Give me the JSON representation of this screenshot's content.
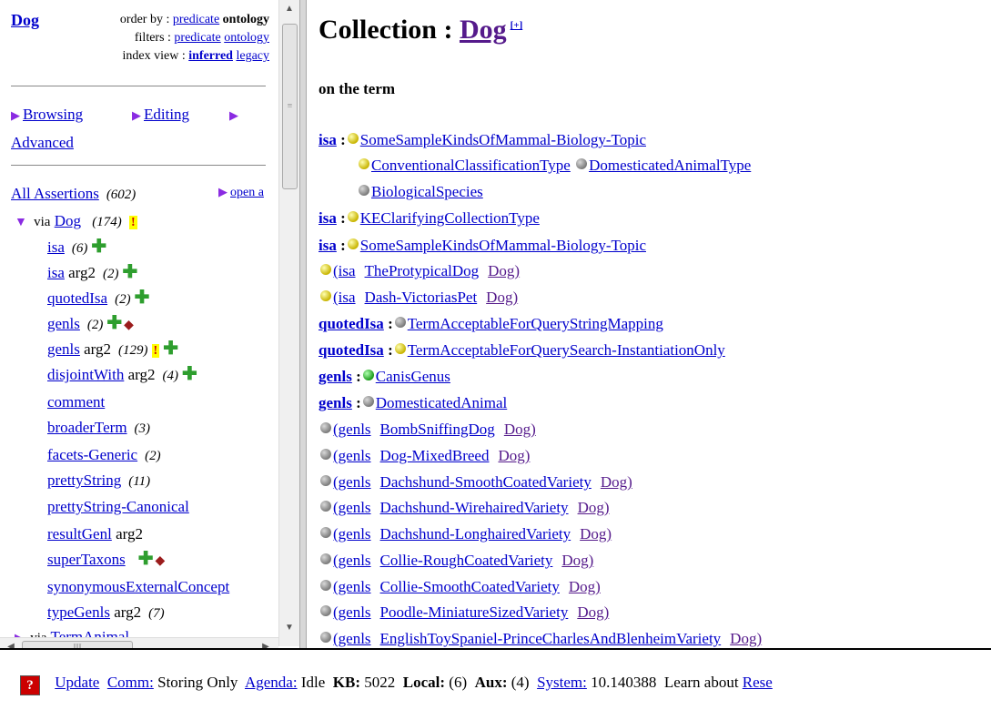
{
  "left": {
    "term": "Dog",
    "order_by_label": "order by :",
    "order_predicate": "predicate",
    "order_ontology": "ontology",
    "filters_label": "filters :",
    "filter_predicate": "predicate",
    "filter_ontology": "ontology",
    "index_view_label": "index view :",
    "index_inferred": "inferred",
    "index_legacy": "legacy",
    "nav": {
      "browsing": "Browsing",
      "editing": "Editing",
      "advanced": "Advanced"
    },
    "all_assertions": "All Assertions",
    "all_count": "(602)",
    "open_all": "open a",
    "via_label": "via",
    "via_term": "Dog",
    "via_count": "(174)",
    "warn": "!",
    "predicates": [
      {
        "name": "isa",
        "suffix": "",
        "count": "(6)"
      },
      {
        "name": "isa",
        "suffix": "arg2",
        "count": "(2)"
      },
      {
        "name": "quotedIsa",
        "suffix": "",
        "count": "(2)"
      },
      {
        "name": "genls",
        "suffix": "",
        "count": "(2)"
      },
      {
        "name": "genls",
        "suffix": "arg2",
        "count": "(129)"
      },
      {
        "name": "disjointWith",
        "suffix": "arg2",
        "count": "(4)"
      },
      {
        "name": "comment",
        "suffix": "",
        "count": ""
      },
      {
        "name": "broaderTerm",
        "suffix": "",
        "count": "(3)"
      },
      {
        "name": "facets-Generic",
        "suffix": "",
        "count": "(2)"
      },
      {
        "name": "prettyString",
        "suffix": "",
        "count": "(11)"
      },
      {
        "name": "prettyString-Canonical",
        "suffix": "",
        "count": ""
      },
      {
        "name": "resultGenl",
        "suffix": "arg2",
        "count": ""
      },
      {
        "name": "superTaxons",
        "suffix": "",
        "count": ""
      },
      {
        "name": "synonymousExternalConcept",
        "suffix": "",
        "count": ""
      },
      {
        "name": "typeGenls",
        "suffix": "arg2",
        "count": "(7)"
      },
      {
        "name": "TermAnimal",
        "suffix": "",
        "count": ""
      }
    ],
    "via_next": "via",
    "scroll_grip": "≡",
    "hscroll_grip": "III"
  },
  "main": {
    "title_prefix": "Collection :",
    "title_term": "Dog",
    "title_plus": "[+]",
    "on_the_term": "on the term",
    "rows": {
      "isa": "isa",
      "quotedIsa": "quotedIsa",
      "genls": "genls",
      "colon": ":",
      "isa1_a": "SomeSampleKindsOfMammal-Biology-Topic",
      "isa1_b": "ConventionalClassificationType",
      "isa1_c": "DomesticatedAnimalType",
      "isa1_d": "BiologicalSpecies",
      "isa2": "KEClarifyingCollectionType",
      "isa3": "SomeSampleKindsOfMammal-Biology-Topic",
      "proto_pred": "(isa",
      "proto_term": "TheProtypicalDog",
      "proto_end": "Dog)",
      "dash_pred": "(isa",
      "dash_term": "Dash-VictoriasPet",
      "dash_end": "Dog)",
      "q1": "TermAcceptableForQueryStringMapping",
      "q2": "TermAcceptableForQuerySearch-InstantiationOnly",
      "g1": "CanisGenus",
      "g2": "DomesticatedAnimal",
      "genls_pred": "(genls",
      "dog_end": "Dog)",
      "specs": [
        "BombSniffingDog",
        "Dog-MixedBreed",
        "Dachshund-SmoothCoatedVariety",
        "Dachshund-WirehairedVariety",
        "Dachshund-LonghairedVariety",
        "Collie-RoughCoatedVariety",
        "Collie-SmoothCoatedVariety",
        "Poodle-MiniatureSizedVariety",
        "EnglishToySpaniel-PrinceCharlesAndBlenheimVariety"
      ]
    }
  },
  "status": {
    "help": "?",
    "update": "Update",
    "comm": "Comm:",
    "comm_val": "Storing Only",
    "agenda": "Agenda:",
    "agenda_val": "Idle",
    "kb_label": "KB:",
    "kb_val": "5022",
    "local_label": "Local:",
    "local_val": "(6)",
    "aux_label": "Aux:",
    "aux_val": "(4)",
    "system": "System:",
    "system_val": "10.140388",
    "learn": "Learn about",
    "rese": "Rese"
  }
}
